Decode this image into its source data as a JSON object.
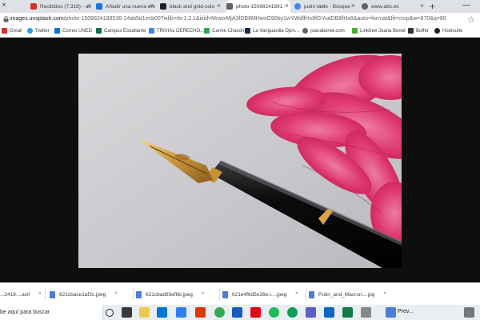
{
  "browser": {
    "tabs": [
      {
        "label": "Recibidos (7.318) - an",
        "color": "#d93025"
      },
      {
        "label": "Añadir una nueva ent",
        "color": "#1a73e8"
      },
      {
        "label": "black and gold-colo",
        "color": "#202124"
      },
      {
        "label": "photo-15098241891 ",
        "color": "#5f6368",
        "active": true
      },
      {
        "label": "putin table - Búsque",
        "color": "#4285f4"
      },
      {
        "label": "www.abc.es",
        "color": "#5f6368"
      }
    ],
    "new_tab": "+",
    "window_minimize": "—",
    "url_domain": "images.unsplash.com",
    "url_path": "/photo-1509824189536-24ab5d1ecb00?ixlib=rb-1.2.1&ixid=MnwxMjA3fDB8MHwxG90by1wYWdlfHx8fGVudDB8fHx8&auto=format&fit=crop&w=870&q=80",
    "bookmarks": [
      {
        "label": "Gmail",
        "color": "#d93025"
      },
      {
        "label": "Twitter",
        "color": "#1da1f2"
      },
      {
        "label": "Correo UNED",
        "color": "#0078d4"
      },
      {
        "label": "Campus Estudiante",
        "color": "#0b6e4f"
      },
      {
        "label": "TRIVIAL DERECHO...",
        "color": "#4285f4"
      },
      {
        "label": "Carme Chacón",
        "color": "#34a853"
      },
      {
        "label": "La Vanguardia Opin...",
        "color": "#1b2a4a"
      },
      {
        "label": "joanabonet.com",
        "color": "#5f6368"
      },
      {
        "label": "Linktree Joana Bonet",
        "color": "#43b02a"
      },
      {
        "label": "Buffer",
        "color": "#333"
      },
      {
        "label": "Hootsuite",
        "color": "#222"
      }
    ]
  },
  "downloads": [
    {
      "name": "...2418....avif"
    },
    {
      "name": "621cbace1af3c.jpeg"
    },
    {
      "name": "621cbad93ef6b.jpeg"
    },
    {
      "name": "621e4f6d5e26e.r....jpeg"
    },
    {
      "name": "Putin_and_Macron....jpg"
    }
  ],
  "taskbar": {
    "search_placeholder": "be aquí para buscar",
    "preview_label": "Prev..."
  }
}
